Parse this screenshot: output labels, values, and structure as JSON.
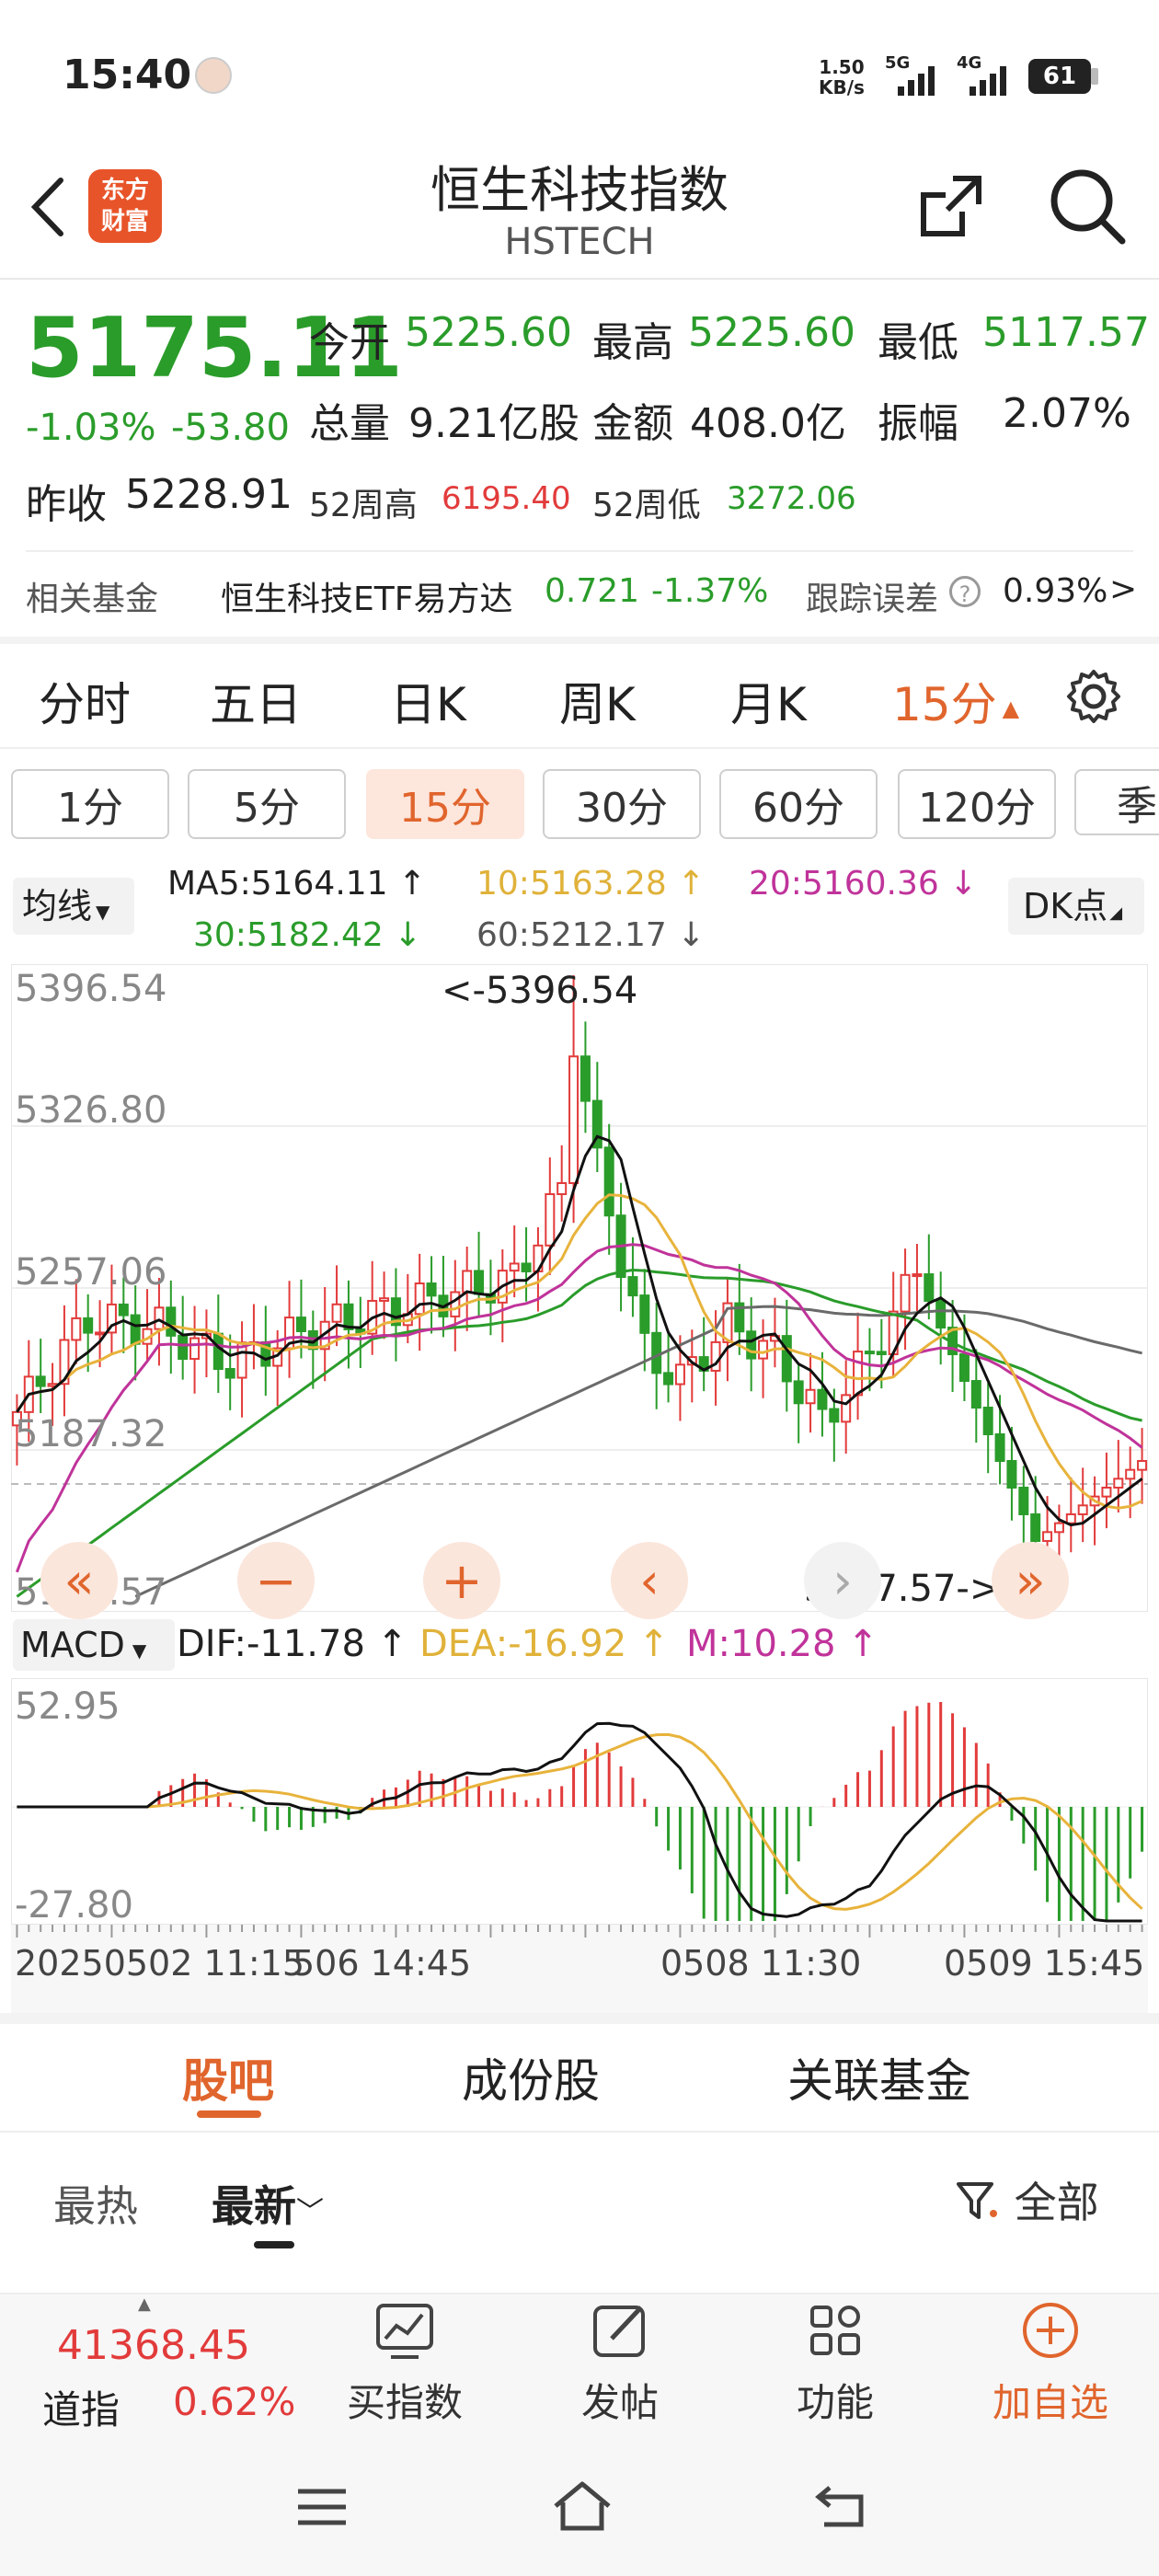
{
  "status": {
    "time": "15:40",
    "net_speed_top": "1.50",
    "net_speed_bottom": "KB/s",
    "sig1": "5G",
    "sig2": "4G",
    "battery": "61"
  },
  "header": {
    "title": "恒生科技指数",
    "subtitle": "HSTECH",
    "logo_line1": "东方",
    "logo_line2": "财富"
  },
  "quote": {
    "price": "5175.11",
    "change_pct": "-1.03%",
    "change": "-53.80",
    "open_label": "今开",
    "open": "5225.60",
    "high_label": "最高",
    "high": "5225.60",
    "low_label": "最低",
    "low": "5117.57",
    "vol_label": "总量",
    "vol": "9.21亿股",
    "amt_label": "金额",
    "amt": "408.0亿",
    "amp_label": "振幅",
    "amp": "2.07%",
    "prev_label": "昨收",
    "prev": "5228.91",
    "w52h_label": "52周高",
    "w52h": "6195.40",
    "w52l_label": "52周低",
    "w52l": "3272.06"
  },
  "fund": {
    "label": "相关基金",
    "name": "恒生科技ETF易方达",
    "price": "0.721",
    "pct": "-1.37%",
    "track_label": "跟踪误差",
    "track": "0.93%",
    "arrow": ">"
  },
  "period_tabs": [
    "分时",
    "五日",
    "日K",
    "周K",
    "月K",
    "15分"
  ],
  "minute_tabs": [
    "1分",
    "5分",
    "15分",
    "30分",
    "60分",
    "120分",
    "季"
  ],
  "ma": {
    "selector": "均线",
    "ma5": "MA5:5164.11 ↑",
    "ma10": "10:5163.28 ↑",
    "ma20": "20:5160.36 ↓",
    "ma30": "30:5182.42 ↓",
    "ma60": "60:5212.17 ↓",
    "dk": "DK点"
  },
  "kline": {
    "y1": "5396.54",
    "y2": "5326.80",
    "y3": "5257.06",
    "y4": "5187.32",
    "y5": "5117.57",
    "max_label": "<-5396.54",
    "min_label": "5117.57->"
  },
  "macd": {
    "selector": "MACD",
    "dif": "DIF:-11.78 ↑",
    "dea": "DEA:-16.92 ↑",
    "m": "M:10.28 ↑",
    "ytop": "52.95",
    "ybot": "-27.80"
  },
  "xaxis": {
    "l1": "20250502 11:15",
    "l2": "506 14:45",
    "l3": "0508 11:30",
    "l4": "0509 15:45"
  },
  "section_tabs": [
    "股吧",
    "成份股",
    "关联基金"
  ],
  "sub_tabs": {
    "hot": "最热",
    "new": "最新",
    "filter": "全部"
  },
  "bottom": {
    "index_value": "41368.45",
    "index_name": "道指",
    "index_pct": "0.62%",
    "buy": "买指数",
    "post": "发帖",
    "func": "功能",
    "add": "加自选"
  },
  "colors": {
    "accent": "#e0652d",
    "up": "#e23b3b",
    "down": "#2a9c2a"
  }
}
